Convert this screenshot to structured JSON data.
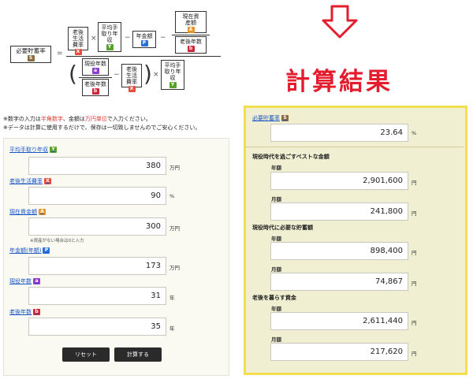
{
  "formula": {
    "needed_rate": {
      "label": "必要貯蓄率",
      "badge": "S"
    },
    "eq": "=",
    "times": "×",
    "minus": "−",
    "living_rate": {
      "label": "老後生活費率",
      "badge": "X"
    },
    "avg_income": {
      "label": "平均手取り年収",
      "badge": "Y"
    },
    "pension": {
      "label": "年金額",
      "badge": "P"
    },
    "current_assets": {
      "label": "現在資産額",
      "badge": "A"
    },
    "retire_years": {
      "label": "老後年数",
      "badge": "b"
    },
    "working_years": {
      "label": "現役年数",
      "badge": "a"
    },
    "retire_years2": {
      "label": "老後年数",
      "badge": "b"
    },
    "living_rate2": {
      "label": "老後生活費率",
      "badge": "X"
    },
    "avg_income2": {
      "label": "平均手取り年収",
      "badge": "Y"
    }
  },
  "result_title": "計算結果",
  "notes": [
    {
      "pre": "※数字の入力は",
      "red1": "半角数字",
      "mid": "、金額は",
      "red2": "万円単位",
      "post": "で入力ください。"
    },
    {
      "pre": "※データは計算に使用するだけで、保存は一切致しませんのでご安心ください。"
    }
  ],
  "inputs": [
    {
      "label": "平均手取り年収",
      "badge": "Y",
      "value": "380",
      "unit": "万円"
    },
    {
      "label": "老後生活費率",
      "badge": "X",
      "value": "90",
      "unit": "%"
    },
    {
      "label": "現在資金額",
      "badge": "A",
      "value": "300",
      "unit": "万円",
      "note": "※資産がない場合は0と入力"
    },
    {
      "label": "年金額(年額)",
      "badge": "P",
      "value": "173",
      "unit": "万円"
    },
    {
      "label": "現役年数",
      "badge": "a",
      "value": "31",
      "unit": "年"
    },
    {
      "label": "老後年数",
      "badge": "b",
      "value": "35",
      "unit": "年"
    }
  ],
  "buttons": {
    "reset": "リセット",
    "calc": "計算する"
  },
  "results": {
    "needed_rate": {
      "label": "必要貯蓄率",
      "badge": "S",
      "value": "23.64",
      "unit": "%"
    },
    "best": {
      "title": "現役時代を過ごすベストな金額",
      "annual_label": "年額",
      "annual": "2,901,600",
      "monthly_label": "月額",
      "monthly": "241,800",
      "unit": "円"
    },
    "saving": {
      "title": "現役時代に必要な貯蓄額",
      "annual_label": "年額",
      "annual": "898,400",
      "monthly_label": "月額",
      "monthly": "74,867",
      "unit": "円"
    },
    "retire": {
      "title": "老後を暮らす資金",
      "annual_label": "年額",
      "annual": "2,611,440",
      "monthly_label": "月額",
      "monthly": "217,620",
      "unit": "円"
    }
  },
  "colors": {
    "accent_red": "#e31d2d",
    "highlight_border": "#f3df4d",
    "result_bg": "#f0efd2",
    "link_blue": "#1a56c6"
  }
}
